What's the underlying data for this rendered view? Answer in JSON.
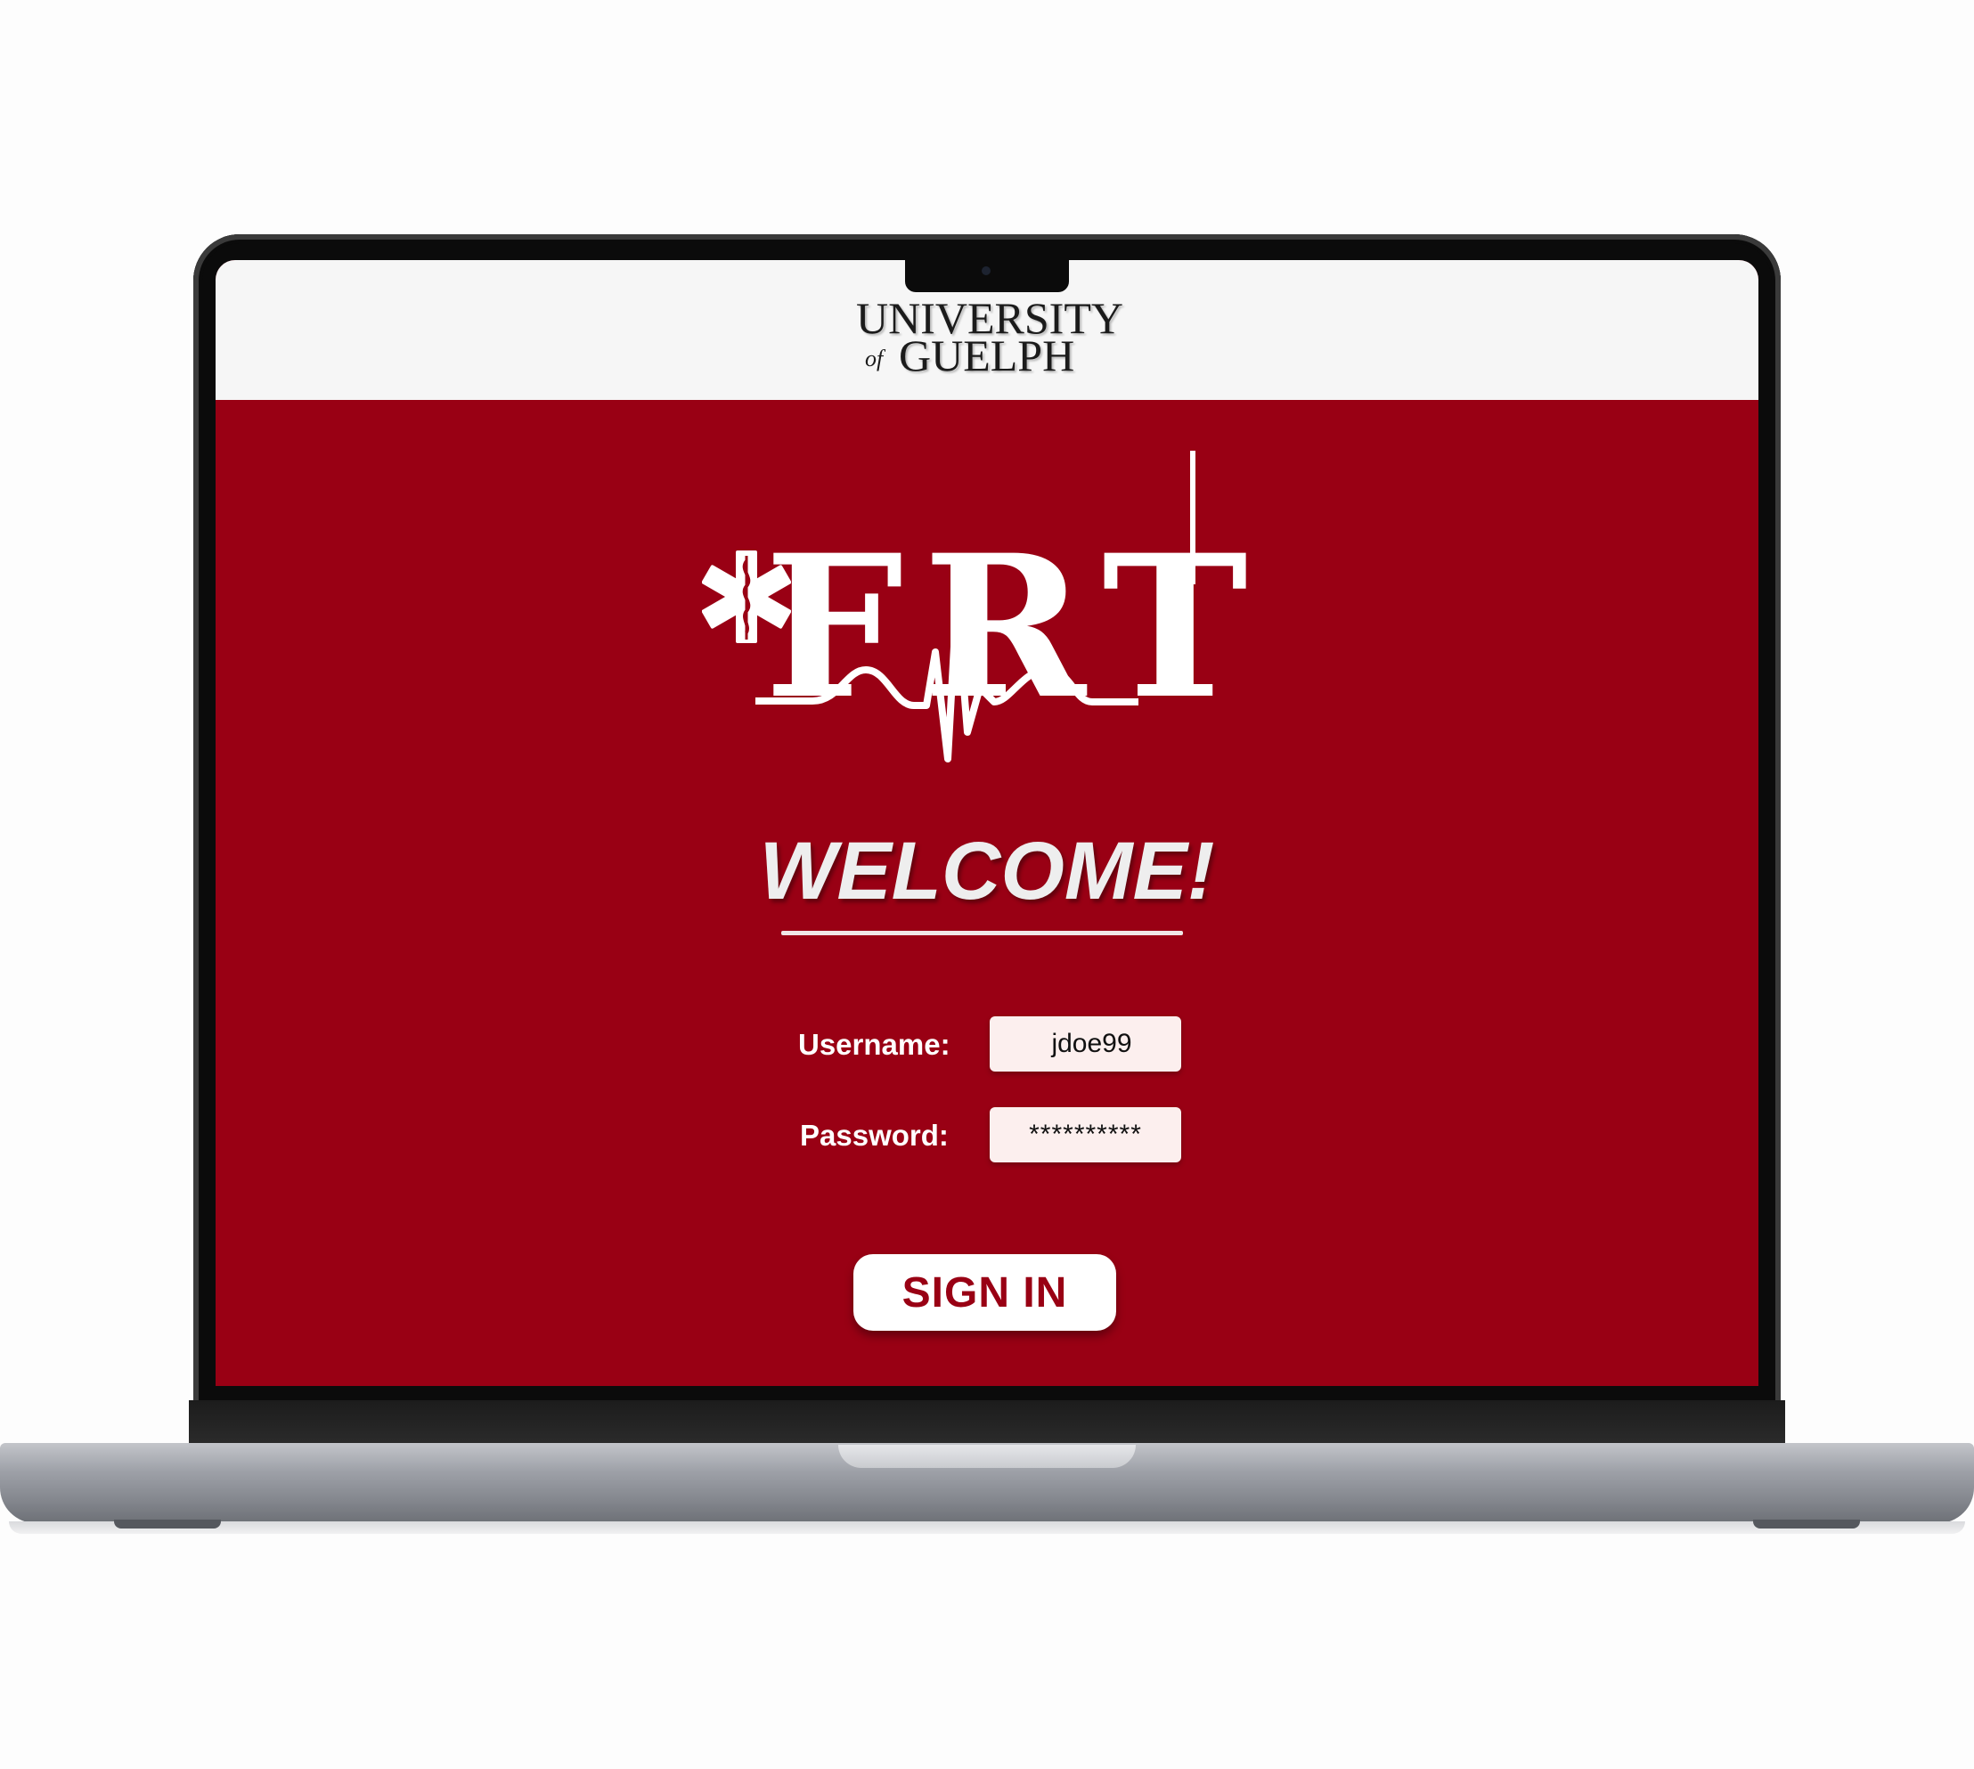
{
  "header": {
    "university_logo": {
      "line1": "UNIVERSITY",
      "of": "of",
      "line2": "GUELPH"
    }
  },
  "brand": {
    "logo_text": "FRT",
    "primary_color": "#990014",
    "header_bg": "#f6f6f6"
  },
  "login": {
    "welcome": "WELCOME!",
    "username_label": "Username:",
    "username_value": "jdoe99",
    "password_label": "Password:",
    "password_value": "**********",
    "signin_label": "SIGN IN"
  },
  "icons": {
    "star_of_life": "star-of-life-icon",
    "ecg": "ecg-line-icon"
  }
}
